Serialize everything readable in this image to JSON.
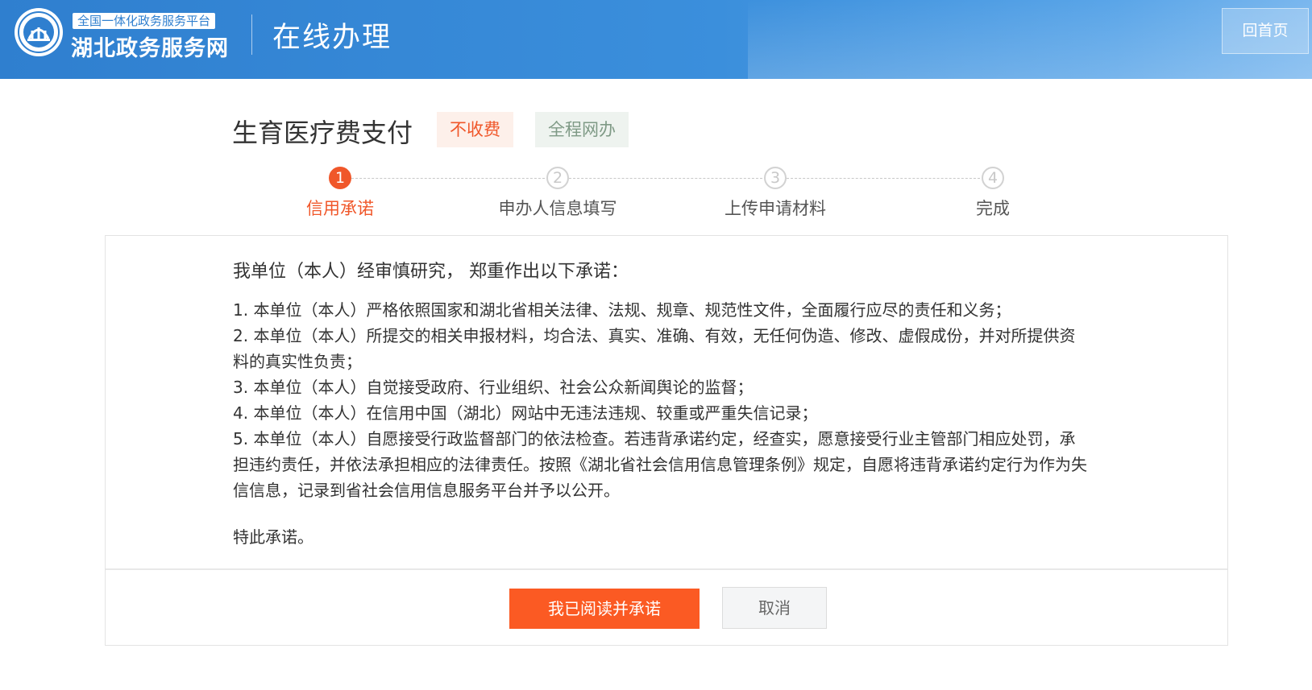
{
  "header": {
    "platform_tag": "全国一体化政务服务平台",
    "site_name": "湖北政务服务网",
    "section_title": "在线办理",
    "home_button": "回首页"
  },
  "service": {
    "title": "生育医疗费支付",
    "badges": [
      "不收费",
      "全程网办"
    ]
  },
  "steps": [
    {
      "number": "1",
      "label": "信用承诺",
      "active": true
    },
    {
      "number": "2",
      "label": "申办人信息填写",
      "active": false
    },
    {
      "number": "3",
      "label": "上传申请材料",
      "active": false
    },
    {
      "number": "4",
      "label": "完成",
      "active": false
    }
  ],
  "pledge": {
    "intro": "我单位（本人）经审慎研究， 郑重作出以下承诺：",
    "items": [
      "1. 本单位（本人）严格依照国家和湖北省相关法律、法规、规章、规范性文件，全面履行应尽的责任和义务；",
      "2. 本单位（本人）所提交的相关申报材料，均合法、真实、准确、有效，无任何伪造、修改、虚假成份，并对所提供资料的真实性负责；",
      "3. 本单位（本人）自觉接受政府、行业组织、社会公众新闻舆论的监督；",
      "4. 本单位（本人）在信用中国（湖北）网站中无违法违规、较重或严重失信记录；",
      "5. 本单位（本人）自愿接受行政监督部门的依法检查。若违背承诺约定，经查实，愿意接受行业主管部门相应处罚，承担违约责任，并依法承担相应的法律责任。按照《湖北省社会信用信息管理条例》规定，自愿将违背承诺约定行为作为失信信息，记录到省社会信用信息服务平台并予以公开。"
    ],
    "closing": "特此承诺。"
  },
  "actions": {
    "agree": "我已阅读并承诺",
    "cancel": "取消"
  },
  "colors": {
    "accent": "#fb5a23",
    "header_blue": "#2f7fcf"
  }
}
